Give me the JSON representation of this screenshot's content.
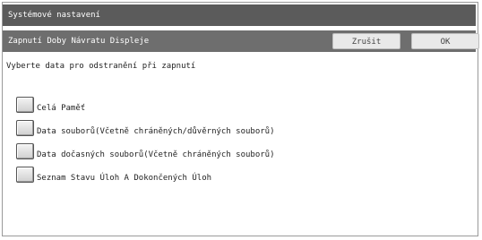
{
  "window": {
    "title": "Systémové nastavení"
  },
  "header": {
    "title": "Zapnutí Doby Návratu Displeje",
    "cancel_label": "Zrušit",
    "ok_label": "OK"
  },
  "main": {
    "instruction": "Vyberte data pro odstranění při zapnutí",
    "options": [
      {
        "label": "Celá Paměť",
        "checked": false
      },
      {
        "label": "Data souborů(Včetně chráněných/důvěrných souborů)",
        "checked": false
      },
      {
        "label": "Data dočasných souborů(Včetně chráněných souborů)",
        "checked": false
      },
      {
        "label": "Seznam Stavu Úloh A Dokončených Úloh",
        "checked": false
      }
    ]
  }
}
